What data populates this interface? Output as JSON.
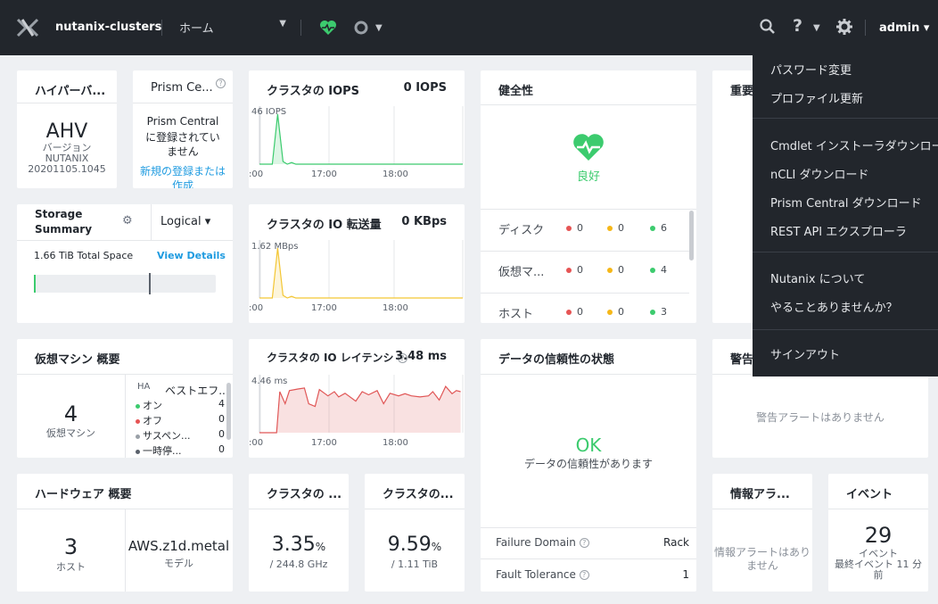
{
  "topbar": {
    "cluster_name": "nutanix-clusters",
    "nav_select": "ホーム",
    "user": "admin",
    "colors": {
      "bg": "#22262c",
      "health": "#3ccb6e"
    }
  },
  "hypervisor": {
    "title": "ハイパーバ...",
    "name": "AHV",
    "label": "バージョン",
    "vendor": "NUTANIX",
    "version": "20201105.1045"
  },
  "prism_central": {
    "title": "Prism Ce...",
    "line1": "Prism Central",
    "line2": "に登録されてい",
    "line3": "ません",
    "link1": "新規の登録または",
    "link2": "作成"
  },
  "storage_summary": {
    "title_line1": "Storage",
    "title_line2": "Summary",
    "view_select": "Logical",
    "total": "1.66 TiB",
    "total_label": "Total Space",
    "details_link": "View Details",
    "used_fraction": 0.005,
    "threshold_fraction": 0.63
  },
  "iops": {
    "title": "クラスタの IOPS",
    "current": "0 IOPS",
    "peak_label": "46 IOPS",
    "ticks": [
      ":00",
      "17:00",
      "18:00"
    ],
    "color": "#3ccb6e"
  },
  "io_bandwidth": {
    "title": "クラスタの IO 転送量",
    "current": "0 KBps",
    "peak_label": "1.62 MBps",
    "ticks": [
      ":00",
      "17:00",
      "18:00"
    ],
    "color": "#f3c634"
  },
  "io_latency": {
    "title": "クラスタの IO レイテンシ",
    "current": "3.48 ms",
    "peak_label": "4.46 ms",
    "ticks": [
      ":00",
      "17:00",
      "18:00"
    ],
    "color": "#e05656"
  },
  "health": {
    "title": "健全性",
    "status": "良好",
    "rows": [
      {
        "label": "ディスク",
        "red": "0",
        "yellow": "0",
        "green": "6"
      },
      {
        "label": "仮想マ...",
        "red": "0",
        "yellow": "0",
        "green": "4"
      },
      {
        "label": "ホスト",
        "red": "0",
        "yellow": "0",
        "green": "3"
      }
    ],
    "colors": {
      "red": "#e65454",
      "yellow": "#f5b718",
      "green": "#3ccb6e"
    }
  },
  "critical_alerts": {
    "title": "重要..."
  },
  "vm_summary": {
    "title": "仮想マシン 概要",
    "count": "4",
    "count_label": "仮想マシン",
    "ha_label": "HA",
    "ha_policy": "ベストエフ...",
    "states": [
      {
        "label": "オン",
        "count": "4",
        "color": "#3ccb6e"
      },
      {
        "label": "オフ",
        "count": "0",
        "color": "#e65454"
      },
      {
        "label": "サスペン...",
        "count": "0",
        "color": "#9aa0a7"
      },
      {
        "label": "一時停...",
        "count": "0",
        "color": "#5a616b"
      }
    ]
  },
  "data_resiliency": {
    "title": "データの信頼性の状態",
    "status": "OK",
    "description": "データの信頼性があります",
    "failure_domain_label": "Failure Domain",
    "failure_domain_value": "Rack",
    "fault_tolerance_label": "Fault Tolerance",
    "fault_tolerance_value": "1"
  },
  "warning_alerts": {
    "title": "警告...",
    "empty": "警告アラートはありません"
  },
  "hardware_summary": {
    "title": "ハードウェア 概要",
    "hosts": "3",
    "hosts_label": "ホスト",
    "model": "AWS.z1d.metal",
    "model_label": "モデル"
  },
  "cluster_cpu": {
    "title": "クラスタの ...",
    "value": "3.35",
    "unit": "%",
    "sub": "/ 244.8 GHz"
  },
  "cluster_mem": {
    "title": "クラスタの...",
    "value": "9.59",
    "unit": "%",
    "sub": "/ 1.11 TiB"
  },
  "info_alerts": {
    "title": "情報アラ...",
    "line1": "情報アラートはあり",
    "line2": "ません"
  },
  "events": {
    "title": "イベント",
    "count": "29",
    "label": "イベント",
    "last_line1": "最終イベント 11 分",
    "last_line2": "前"
  },
  "user_menu": {
    "items_group1": [
      "パスワード変更",
      "プロファイル更新"
    ],
    "items_group2": [
      "Cmdlet インストーラダウンロード",
      "nCLI ダウンロード",
      "Prism Central ダウンロード",
      "REST API エクスプローラ"
    ],
    "items_group3": [
      "Nutanix について",
      "やることありませんか？"
    ],
    "sign_out": "サインアウト"
  }
}
